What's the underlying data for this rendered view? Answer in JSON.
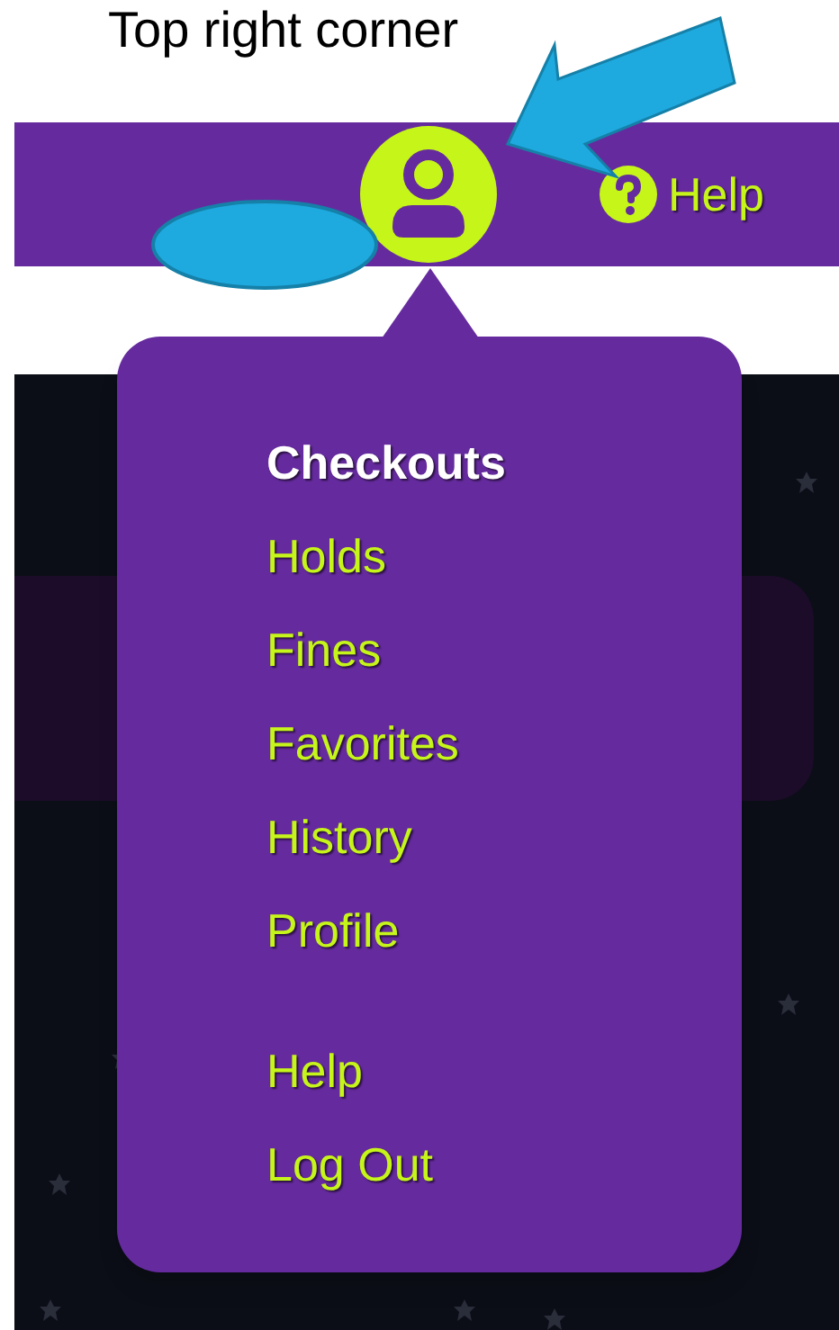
{
  "caption": "Top right corner",
  "header": {
    "help_label": "Help"
  },
  "menu": {
    "groups": [
      [
        {
          "label": "Checkouts",
          "selected": true
        },
        {
          "label": "Holds",
          "selected": false
        },
        {
          "label": "Fines",
          "selected": false
        },
        {
          "label": "Favorites",
          "selected": false
        },
        {
          "label": "History",
          "selected": false
        },
        {
          "label": "Profile",
          "selected": false
        }
      ],
      [
        {
          "label": "Help",
          "selected": false
        },
        {
          "label": "Log Out",
          "selected": false
        }
      ]
    ]
  }
}
